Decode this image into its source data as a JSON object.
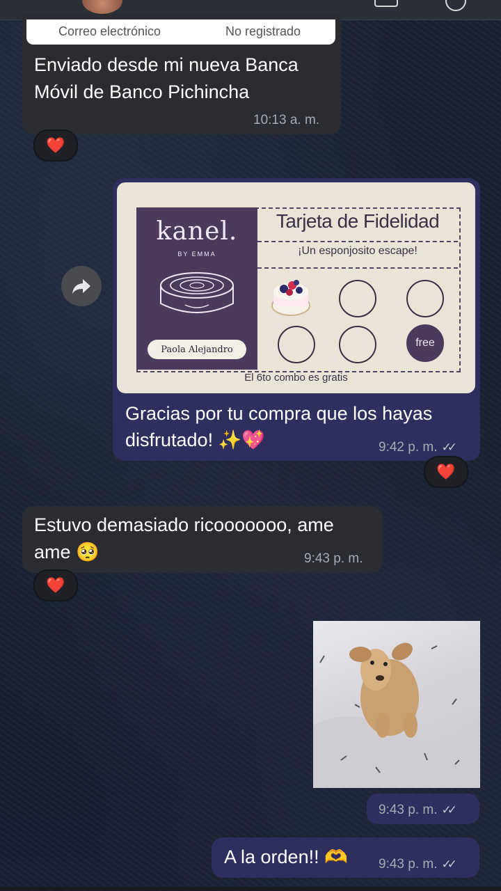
{
  "receipt": {
    "email_label": "Correo electrónico",
    "email_value": "No registrado"
  },
  "messages": [
    {
      "id": "m1",
      "text_line1": "Enviado desde mi nueva Banca",
      "text_line2": "Móvil de Banco Pichincha",
      "time": "10:13 a. m.",
      "reaction": "❤️"
    },
    {
      "id": "m2",
      "card": {
        "logo": "kanel.",
        "byline": "BY EMMA",
        "customer_name": "Paola Alejandro",
        "title": "Tarjeta de Fidelidad",
        "subtitle": "¡Un esponjosito escape!",
        "free_label": "free",
        "footer": "El 6to combo es gratis"
      },
      "caption_line1": "Gracias por tu compra que los hayas",
      "caption_line2": "disfrutado! ✨💖",
      "time": "9:42 p. m.",
      "reaction": "❤️"
    },
    {
      "id": "m3",
      "text_line1": "Estuvo demasiado ricooooooo, ame",
      "text_line2": "ame 🥺",
      "time": "9:43 p. m.",
      "reaction": "❤️"
    },
    {
      "id": "m4",
      "time": "9:43 p. m."
    },
    {
      "id": "m5",
      "text": "A la orden!! 🫶",
      "time": "9:43 p. m."
    }
  ],
  "colors": {
    "incoming_bubble": "#2a2c31",
    "outgoing_bubble": "#2e2f5e",
    "card_purple": "#4b3a5c",
    "card_cream": "#e9e3d8"
  },
  "icons": [
    "forward-icon",
    "double-check-icon",
    "heart-reaction-icon"
  ]
}
